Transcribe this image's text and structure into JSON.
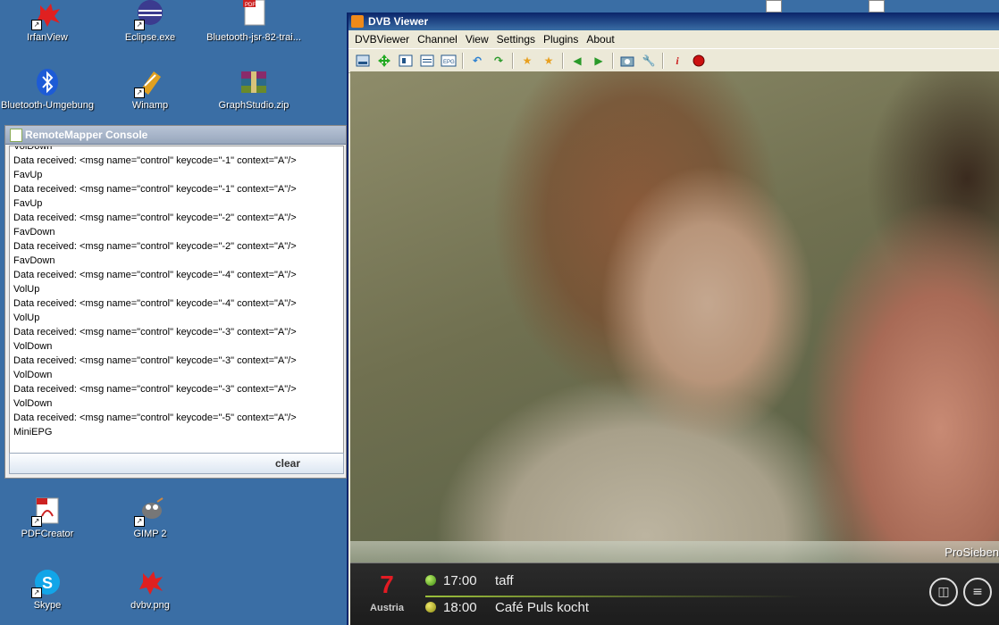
{
  "desktop_icons": [
    {
      "id": "irfanview",
      "label": "IrfanView",
      "color": "#e02020"
    },
    {
      "id": "eclipse",
      "label": "Eclipse.exe",
      "color": "#3b3b8f"
    },
    {
      "id": "bluetooth-jsr",
      "label": "Bluetooth-jsr-82-trai...",
      "color": "#cc2222"
    },
    {
      "id": "bluetooth-umgebung",
      "label": "Bluetooth-Umgebung",
      "color": "#1d5bd6"
    },
    {
      "id": "winamp",
      "label": "Winamp",
      "color": "#e0a020"
    },
    {
      "id": "graphstudio",
      "label": "GraphStudio.zip",
      "color": "#8a2b6a"
    },
    {
      "id": "pdfcreator",
      "label": "PDFCreator",
      "color": "#cc2222"
    },
    {
      "id": "gimp",
      "label": "GIMP 2",
      "color": "#666666"
    },
    {
      "id": "skype",
      "label": "Skype",
      "color": "#12a5e8"
    },
    {
      "id": "dvbv",
      "label": "dvbv.png",
      "color": "#e02020"
    }
  ],
  "console": {
    "title": "RemoteMapper Console",
    "lines": [
      "VolDown",
      "Data received: <msg name=\"control\" keycode=\"-1\" context=\"A\"/>",
      "FavUp",
      "Data received: <msg name=\"control\" keycode=\"-1\" context=\"A\"/>",
      "FavUp",
      "Data received: <msg name=\"control\" keycode=\"-2\" context=\"A\"/>",
      "FavDown",
      "Data received: <msg name=\"control\" keycode=\"-2\" context=\"A\"/>",
      "FavDown",
      "Data received: <msg name=\"control\" keycode=\"-4\" context=\"A\"/>",
      "VolUp",
      "Data received: <msg name=\"control\" keycode=\"-4\" context=\"A\"/>",
      "VolUp",
      "Data received: <msg name=\"control\" keycode=\"-3\" context=\"A\"/>",
      "VolDown",
      "Data received: <msg name=\"control\" keycode=\"-3\" context=\"A\"/>",
      "VolDown",
      "Data received: <msg name=\"control\" keycode=\"-3\" context=\"A\"/>",
      "VolDown",
      "Data received: <msg name=\"control\" keycode=\"-5\" context=\"A\"/>",
      "MiniEPG"
    ],
    "clear_label": "clear"
  },
  "dvb": {
    "title": "DVB Viewer",
    "menu": [
      "DVBViewer",
      "Channel",
      "View",
      "Settings",
      "Plugins",
      "About"
    ],
    "toolbar_icons": [
      "osd-icon",
      "move-icon",
      "teletext-icon",
      "window-icon",
      "epg-icon",
      "back-icon",
      "forward-icon",
      "fav-prev-icon",
      "fav-next-icon",
      "vol-down-icon",
      "vol-up-icon",
      "snapshot-icon",
      "options-icon",
      "info-icon",
      "record-icon"
    ],
    "channel_name": "ProSieben",
    "osd": {
      "logo": "7",
      "region": "Austria",
      "now": {
        "time": "17:00",
        "title": "taff"
      },
      "next": {
        "time": "18:00",
        "title": "Café Puls kocht"
      }
    }
  }
}
